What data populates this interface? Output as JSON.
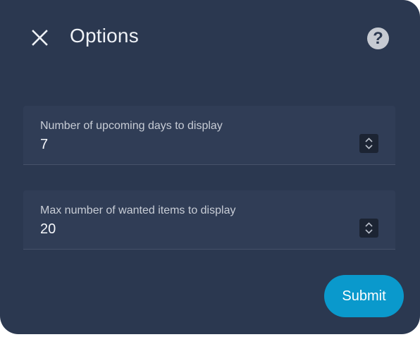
{
  "dialog": {
    "title": "Options",
    "close_icon": "close-icon",
    "help_icon": "help-icon",
    "help_glyph": "?"
  },
  "fields": [
    {
      "label": "Number of upcoming days to display",
      "value": "7",
      "stepper_icon": "chevron-up-down-icon"
    },
    {
      "label": "Max number of wanted items to display",
      "value": "20",
      "stepper_icon": "chevron-up-down-icon"
    }
  ],
  "actions": {
    "submit_label": "Submit"
  },
  "colors": {
    "dialog_background": "#2b3850",
    "field_background": "#303d56",
    "accent": "#0a99cc",
    "text_primary": "#eef1f6",
    "text_label": "#c8cdd6"
  }
}
